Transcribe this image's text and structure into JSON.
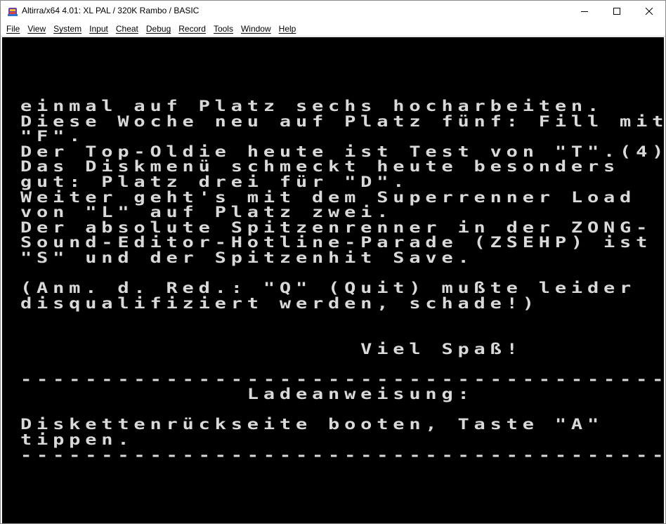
{
  "window": {
    "title": "Altirra/x64 4.01: XL PAL / 320K Rambo / BASIC"
  },
  "menu": {
    "items": [
      {
        "label": "File",
        "name": "menu-file"
      },
      {
        "label": "View",
        "name": "menu-view"
      },
      {
        "label": "System",
        "name": "menu-system"
      },
      {
        "label": "Input",
        "name": "menu-input"
      },
      {
        "label": "Cheat",
        "name": "menu-cheat"
      },
      {
        "label": "Debug",
        "name": "menu-debug"
      },
      {
        "label": "Record",
        "name": "menu-record"
      },
      {
        "label": "Tools",
        "name": "menu-tools"
      },
      {
        "label": "Window",
        "name": "menu-window"
      },
      {
        "label": "Help",
        "name": "menu-help"
      }
    ]
  },
  "screen": {
    "lines": [
      "einmal auf Platz sechs hocharbeiten.",
      "Diese Woche neu auf Platz fünf: Fill mit",
      "\"F\".",
      "Der Top-Oldie heute ist Test von \"T\".(4)",
      "Das Diskmenü schmeckt heute besonders",
      "gut: Platz drei für \"D\".",
      "Weiter geht's mit dem Superrenner Load",
      "von \"L\" auf Platz zwei.",
      "Der absolute Spitzenrenner in der ZONG-",
      "Sound-Editor-Hotline-Parade (ZSEHP) ist",
      "\"S\" und der Spitzenhit Save.",
      "",
      "(Anm. d. Red.: \"Q\" (Quit) mußte leider",
      "disqualifiziert werden, schade!)",
      "",
      "",
      "                     Viel Spaß!",
      "",
      "----------------------------------------",
      "              Ladeanweisung:",
      "",
      "Diskettenrückseite booten, Taste \"A\"",
      "tippen.",
      "----------------------------------------"
    ]
  },
  "colors": {
    "screen_background": "#000000",
    "screen_text": "#d9d9d9"
  },
  "icons": {
    "app": "altirra-app-icon",
    "minimize": "minimize-icon",
    "maximize": "maximize-icon",
    "close": "close-icon"
  }
}
